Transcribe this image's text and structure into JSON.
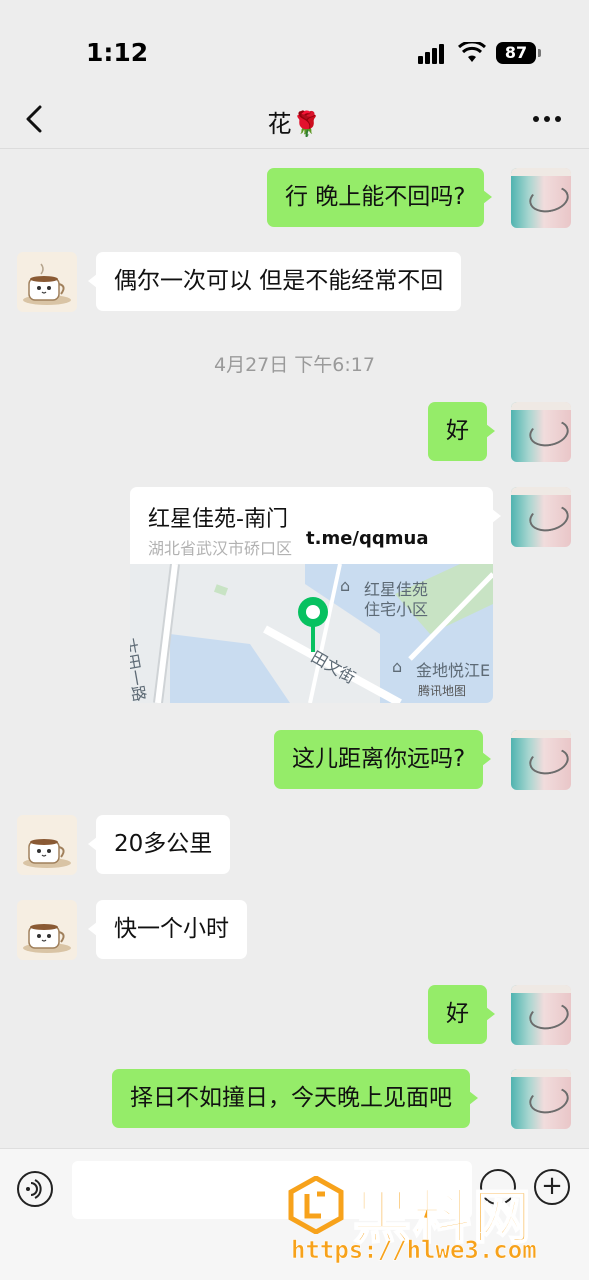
{
  "status_bar": {
    "time": "1:12",
    "battery": "87"
  },
  "nav": {
    "title": "花🌹"
  },
  "messages": [
    {
      "side": "out",
      "text": "行 晚上能不回吗?"
    },
    {
      "side": "in",
      "text": "偶尔一次可以 但是不能经常不回"
    },
    {
      "side": "out",
      "text": "好"
    },
    {
      "side": "out",
      "text": "这儿距离你远吗?"
    },
    {
      "side": "in",
      "text": "20多公里"
    },
    {
      "side": "in",
      "text": "快一个小时"
    },
    {
      "side": "out",
      "text": "好"
    },
    {
      "side": "out",
      "text": "择日不如撞日，今天晚上见面吧"
    }
  ],
  "timestamp": "4月27日 下午6:17",
  "location": {
    "name": "红星佳苑-南门",
    "address": "湖北省武汉市硚口区",
    "overlay_text": "t.me/qqmua",
    "map_labels": {
      "poi1_line1": "红星佳苑",
      "poi1_line2": "住宅小区",
      "road1": "田文街",
      "road2": "古田一路",
      "poi2": "金地悦江E",
      "attribution": "腾讯地图"
    }
  },
  "input": {
    "placeholder": ""
  },
  "watermark": {
    "brand": "黑料网",
    "url": "https://hlwe3.com"
  },
  "colors": {
    "outgoing_bubble": "#95ec69",
    "incoming_bubble": "#ffffff",
    "background": "#ededed",
    "watermark": "#f7a21b"
  }
}
